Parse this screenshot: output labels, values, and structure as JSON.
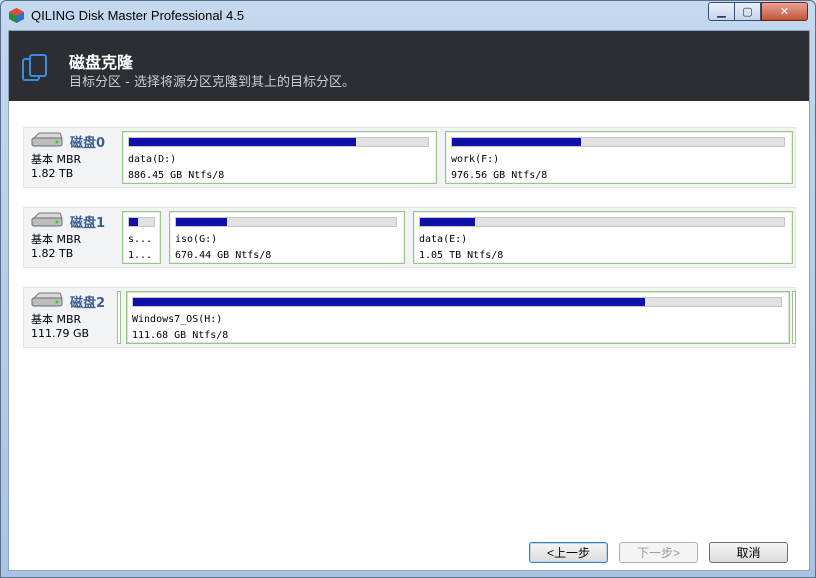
{
  "window": {
    "title": "QILING Disk Master Professional 4.5"
  },
  "header": {
    "title": "磁盘克隆",
    "subtitle": "目标分区 - 选择将源分区克隆到其上的目标分区。"
  },
  "disks": [
    {
      "name": "磁盘0",
      "type": "基本 MBR",
      "size": "1.82 TB",
      "partitions": [
        {
          "label": "data(D:)",
          "info": "886.45 GB Ntfs/8",
          "used_fraction": 0.76
        },
        {
          "label": "work(F:)",
          "info": "976.56 GB Ntfs/8",
          "used_fraction": 0.39
        }
      ]
    },
    {
      "name": "磁盘1",
      "type": "基本 MBR",
      "size": "1.82 TB",
      "partitions": [
        {
          "label": "s...",
          "info": "1...",
          "used_fraction": 0.35
        },
        {
          "label": "iso(G:)",
          "info": "670.44 GB Ntfs/8",
          "used_fraction": 0.23
        },
        {
          "label": "data(E:)",
          "info": "1.05 TB Ntfs/8",
          "used_fraction": 0.15
        }
      ]
    },
    {
      "name": "磁盘2",
      "type": "基本 MBR",
      "size": "111.79 GB",
      "partitions": [
        {
          "label": "Windows7_OS(H:)",
          "info": "111.68 GB Ntfs/8",
          "used_fraction": 0.79
        }
      ]
    }
  ],
  "buttons": {
    "back": "<上一步",
    "next": "下一步>",
    "cancel": "取消"
  },
  "colors": {
    "header_bg": "#2b2e33",
    "used_bar": "#1010a8",
    "partition_border": "#9bc58a",
    "disk_name": "#3a5f8f"
  }
}
